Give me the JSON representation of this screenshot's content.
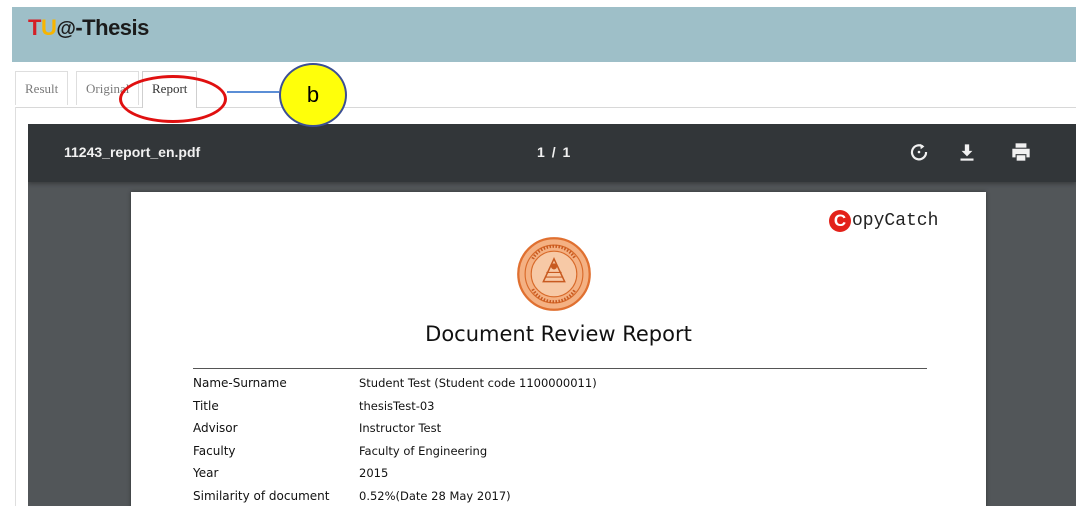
{
  "app": {
    "logo_t": "T",
    "logo_u": "U",
    "logo_at": "@",
    "logo_rest": "-Thesis"
  },
  "tabs": [
    {
      "label": "Result",
      "active": false
    },
    {
      "label": "Original",
      "active": false
    },
    {
      "label": "Report",
      "active": true
    }
  ],
  "annotation": {
    "label": "b",
    "highlight_color": "#e01010",
    "badge_color": "#ffff0a"
  },
  "viewer": {
    "filename": "11243_report_en.pdf",
    "page_current": "1",
    "page_separator": "/",
    "page_total": "1",
    "icons": [
      "rotate-icon",
      "download-icon",
      "print-icon"
    ]
  },
  "report": {
    "brand_letter": "C",
    "brand_word": "opyCatch",
    "title": "Document Review Report",
    "fields": [
      {
        "label": "Name-Surname",
        "value": "Student Test (Student code 1100000011)"
      },
      {
        "label": "Title",
        "value": "thesisTest-03"
      },
      {
        "label": "Advisor",
        "value": "Instructor Test"
      },
      {
        "label": "Faculty",
        "value": "Faculty of Engineering"
      },
      {
        "label": "Year",
        "value": "2015"
      },
      {
        "label": "Similarity of document",
        "value": "0.52%(Date 28 May 2017)"
      }
    ]
  },
  "colors": {
    "header": "#9ebfc8",
    "toolbar": "#323639",
    "viewer_bg": "#525659",
    "brand_red": "#e32119"
  }
}
